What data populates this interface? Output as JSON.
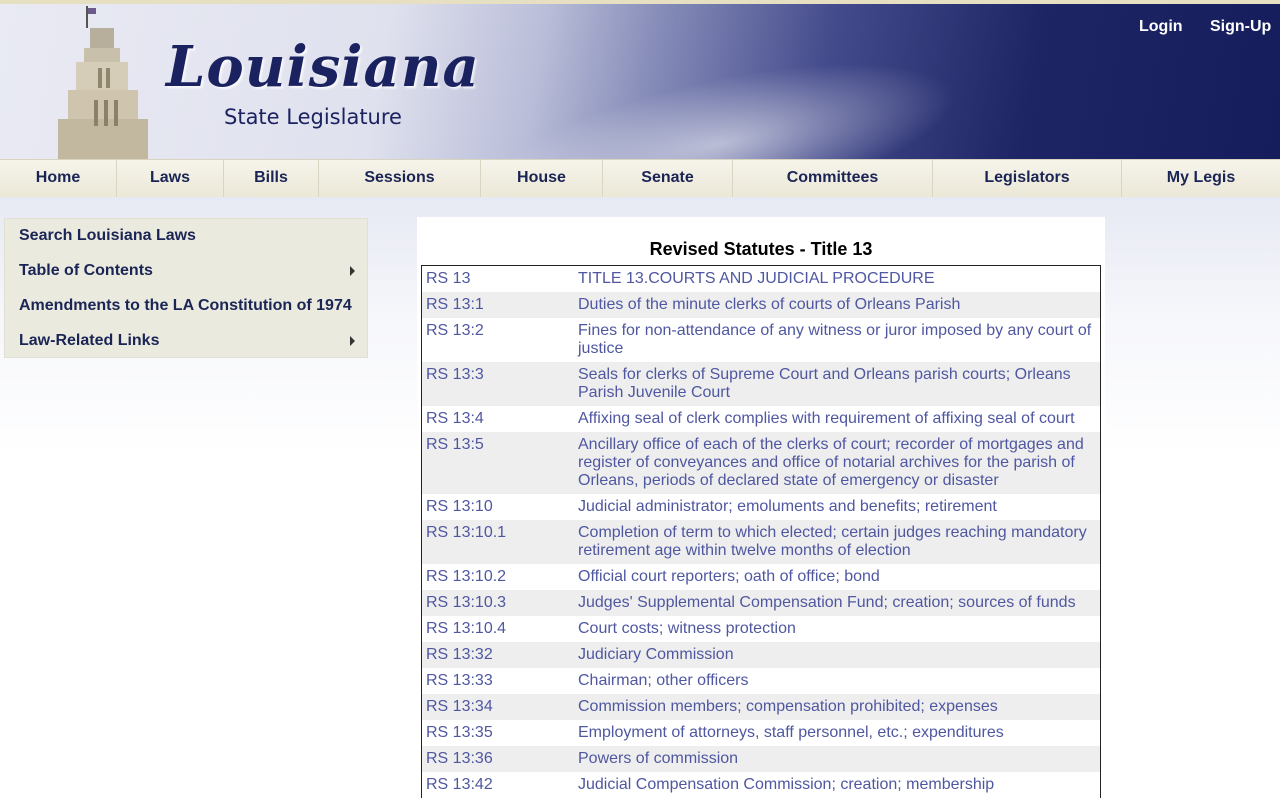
{
  "header": {
    "logo_script": "Louisiana",
    "logo_sub": "State Legislature",
    "login": "Login",
    "signup": "Sign-Up"
  },
  "nav": [
    "Home",
    "Laws",
    "Bills",
    "Sessions",
    "House",
    "Senate",
    "Committees",
    "Legislators",
    "My Legis"
  ],
  "sidebar": {
    "items": [
      {
        "label": "Search Louisiana Laws"
      },
      {
        "label": "Table of Contents"
      },
      {
        "label": "Amendments to the LA Constitution of 1974"
      },
      {
        "label": "Law-Related Links"
      }
    ]
  },
  "content": {
    "title": "Revised Statutes - Title 13",
    "rows": [
      {
        "code": "RS 13",
        "desc": "TITLE 13.COURTS AND JUDICIAL PROCEDURE"
      },
      {
        "code": "RS 13:1",
        "desc": "Duties of the minute clerks of courts of Orleans Parish"
      },
      {
        "code": "RS 13:2",
        "desc": "Fines for non-attendance of any witness or juror imposed by any court of justice"
      },
      {
        "code": "RS 13:3",
        "desc": "Seals for clerks of Supreme Court and Orleans parish courts; Orleans Parish Juvenile Court"
      },
      {
        "code": "RS 13:4",
        "desc": "Affixing seal of clerk complies with requirement of affixing seal of court"
      },
      {
        "code": "RS 13:5",
        "desc": "Ancillary office of each of the clerks of court; recorder of mortgages and register of conveyances and office of notarial archives for the parish of Orleans, periods of declared state of emergency or disaster"
      },
      {
        "code": "RS 13:10",
        "desc": "Judicial administrator; emoluments and benefits; retirement"
      },
      {
        "code": "RS 13:10.1",
        "desc": "Completion of term to which elected; certain judges reaching mandatory retirement age within twelve months of election"
      },
      {
        "code": "RS 13:10.2",
        "desc": "Official court reporters; oath of office; bond"
      },
      {
        "code": "RS 13:10.3",
        "desc": "Judges' Supplemental Compensation Fund; creation; sources of funds"
      },
      {
        "code": "RS 13:10.4",
        "desc": "Court costs; witness protection"
      },
      {
        "code": "RS 13:32",
        "desc": "Judiciary Commission"
      },
      {
        "code": "RS 13:33",
        "desc": "Chairman; other officers"
      },
      {
        "code": "RS 13:34",
        "desc": "Commission members; compensation prohibited; expenses"
      },
      {
        "code": "RS 13:35",
        "desc": "Employment of attorneys, staff personnel, etc.; expenditures"
      },
      {
        "code": "RS 13:36",
        "desc": "Powers of commission"
      },
      {
        "code": "RS 13:42",
        "desc": "Judicial Compensation Commission; creation; membership"
      }
    ]
  }
}
